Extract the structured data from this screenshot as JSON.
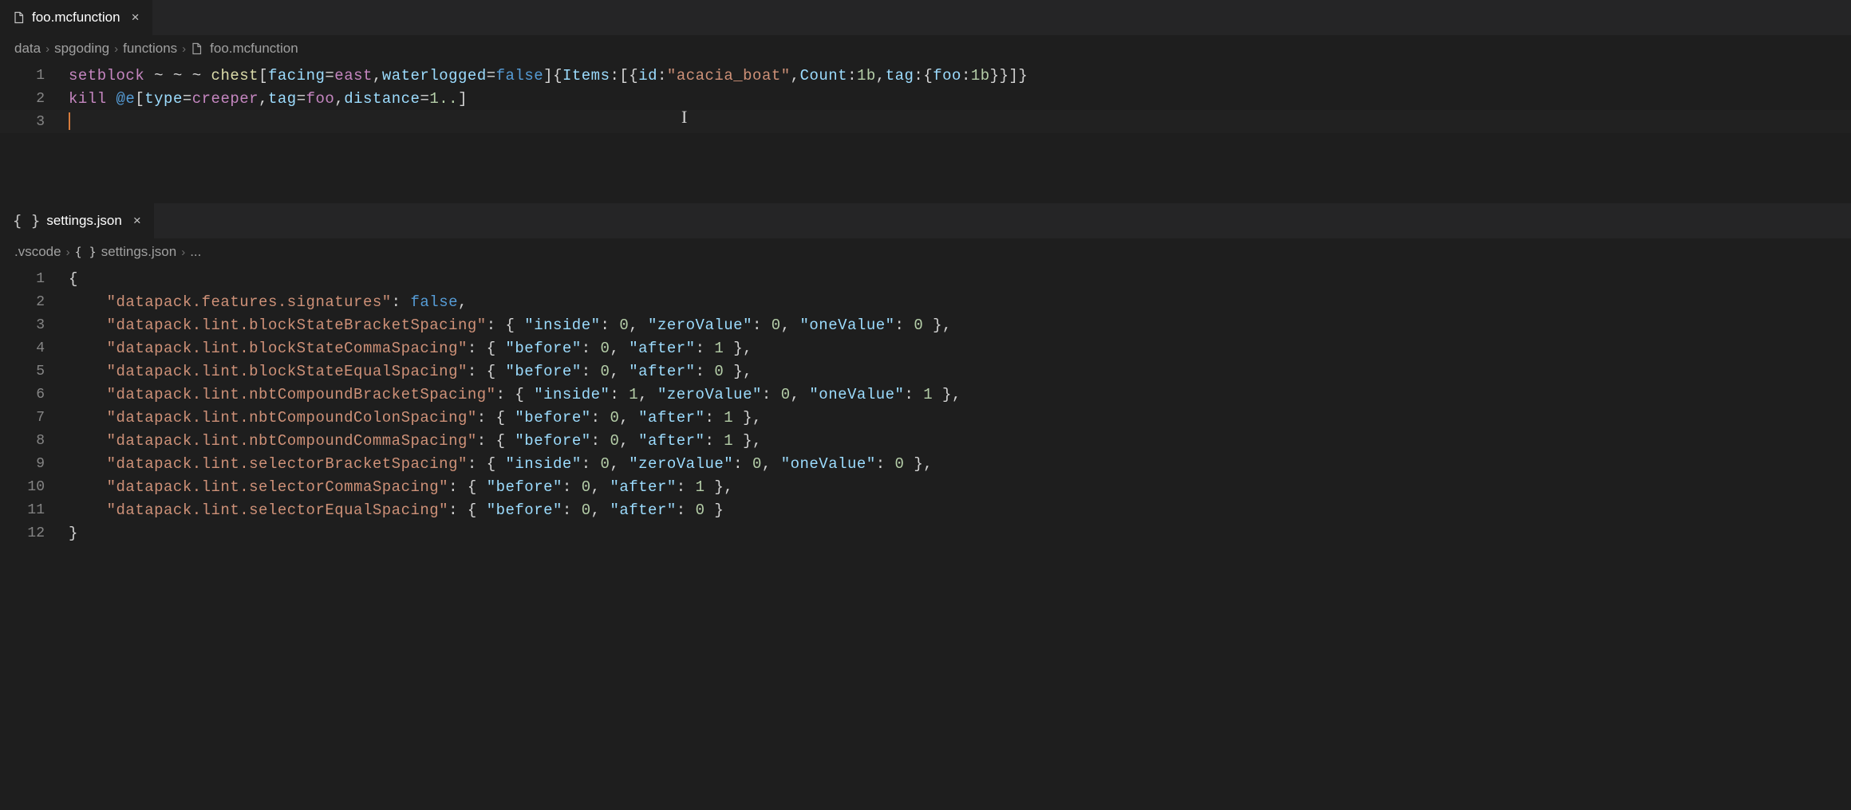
{
  "top_editor": {
    "tab": {
      "label": "foo.mcfunction"
    },
    "breadcrumbs": [
      "data",
      "spgoding",
      "functions",
      "foo.mcfunction"
    ],
    "lines": [
      {
        "n": "1",
        "segs": [
          {
            "c": "k-cmd",
            "t": "setblock"
          },
          {
            "c": "",
            "t": " ~ ~ ~ "
          },
          {
            "c": "k-block",
            "t": "chest"
          },
          {
            "c": "k-punct",
            "t": "["
          },
          {
            "c": "k-prop",
            "t": "facing"
          },
          {
            "c": "k-eq",
            "t": "="
          },
          {
            "c": "k-val",
            "t": "east"
          },
          {
            "c": "k-punct",
            "t": ","
          },
          {
            "c": "k-prop",
            "t": "waterlogged"
          },
          {
            "c": "k-eq",
            "t": "="
          },
          {
            "c": "k-bool",
            "t": "false"
          },
          {
            "c": "k-punct",
            "t": "]"
          },
          {
            "c": "k-brace",
            "t": "{"
          },
          {
            "c": "k-key",
            "t": "Items"
          },
          {
            "c": "k-punct",
            "t": ":["
          },
          {
            "c": "k-brace",
            "t": "{"
          },
          {
            "c": "k-key",
            "t": "id"
          },
          {
            "c": "k-punct",
            "t": ":"
          },
          {
            "c": "k-str",
            "t": "\"acacia_boat\""
          },
          {
            "c": "k-punct",
            "t": ","
          },
          {
            "c": "k-key",
            "t": "Count"
          },
          {
            "c": "k-punct",
            "t": ":"
          },
          {
            "c": "k-num",
            "t": "1b"
          },
          {
            "c": "k-punct",
            "t": ","
          },
          {
            "c": "k-key",
            "t": "tag"
          },
          {
            "c": "k-punct",
            "t": ":"
          },
          {
            "c": "k-brace",
            "t": "{"
          },
          {
            "c": "k-key",
            "t": "foo"
          },
          {
            "c": "k-punct",
            "t": ":"
          },
          {
            "c": "k-num",
            "t": "1b"
          },
          {
            "c": "k-brace",
            "t": "}}"
          },
          {
            "c": "k-punct",
            "t": "]"
          },
          {
            "c": "k-brace",
            "t": "}"
          }
        ]
      },
      {
        "n": "2",
        "segs": [
          {
            "c": "k-cmd",
            "t": "kill"
          },
          {
            "c": "",
            "t": " "
          },
          {
            "c": "k-sel",
            "t": "@e"
          },
          {
            "c": "k-punct",
            "t": "["
          },
          {
            "c": "k-prop",
            "t": "type"
          },
          {
            "c": "k-eq",
            "t": "="
          },
          {
            "c": "k-val",
            "t": "creeper"
          },
          {
            "c": "k-punct",
            "t": ","
          },
          {
            "c": "k-prop",
            "t": "tag"
          },
          {
            "c": "k-eq",
            "t": "="
          },
          {
            "c": "k-val",
            "t": "foo"
          },
          {
            "c": "k-punct",
            "t": ","
          },
          {
            "c": "k-prop",
            "t": "distance"
          },
          {
            "c": "k-eq",
            "t": "="
          },
          {
            "c": "k-range",
            "t": "1.."
          },
          {
            "c": "k-punct",
            "t": "]"
          }
        ]
      },
      {
        "n": "3",
        "segs": []
      }
    ]
  },
  "bottom_editor": {
    "tab": {
      "label": "settings.json"
    },
    "breadcrumbs": [
      ".vscode",
      "settings.json",
      "..."
    ],
    "lines": [
      {
        "n": "1",
        "segs": [
          {
            "c": "json-punct",
            "t": "{"
          }
        ]
      },
      {
        "n": "2",
        "segs": [
          {
            "c": "",
            "t": "    "
          },
          {
            "c": "json-str",
            "t": "\"datapack.features.signatures\""
          },
          {
            "c": "json-punct",
            "t": ": "
          },
          {
            "c": "json-bool",
            "t": "false"
          },
          {
            "c": "json-punct",
            "t": ","
          }
        ]
      },
      {
        "n": "3",
        "segs": [
          {
            "c": "",
            "t": "    "
          },
          {
            "c": "json-str",
            "t": "\"datapack.lint.blockStateBracketSpacing\""
          },
          {
            "c": "json-punct",
            "t": ": { "
          },
          {
            "c": "json-key",
            "t": "\"inside\""
          },
          {
            "c": "json-punct",
            "t": ": "
          },
          {
            "c": "json-num",
            "t": "0"
          },
          {
            "c": "json-punct",
            "t": ", "
          },
          {
            "c": "json-key",
            "t": "\"zeroValue\""
          },
          {
            "c": "json-punct",
            "t": ": "
          },
          {
            "c": "json-num",
            "t": "0"
          },
          {
            "c": "json-punct",
            "t": ", "
          },
          {
            "c": "json-key",
            "t": "\"oneValue\""
          },
          {
            "c": "json-punct",
            "t": ": "
          },
          {
            "c": "json-num",
            "t": "0"
          },
          {
            "c": "json-punct",
            "t": " },"
          }
        ]
      },
      {
        "n": "4",
        "segs": [
          {
            "c": "",
            "t": "    "
          },
          {
            "c": "json-str",
            "t": "\"datapack.lint.blockStateCommaSpacing\""
          },
          {
            "c": "json-punct",
            "t": ": { "
          },
          {
            "c": "json-key",
            "t": "\"before\""
          },
          {
            "c": "json-punct",
            "t": ": "
          },
          {
            "c": "json-num",
            "t": "0"
          },
          {
            "c": "json-punct",
            "t": ", "
          },
          {
            "c": "json-key",
            "t": "\"after\""
          },
          {
            "c": "json-punct",
            "t": ": "
          },
          {
            "c": "json-num",
            "t": "1"
          },
          {
            "c": "json-punct",
            "t": " },"
          }
        ]
      },
      {
        "n": "5",
        "segs": [
          {
            "c": "",
            "t": "    "
          },
          {
            "c": "json-str",
            "t": "\"datapack.lint.blockStateEqualSpacing\""
          },
          {
            "c": "json-punct",
            "t": ": { "
          },
          {
            "c": "json-key",
            "t": "\"before\""
          },
          {
            "c": "json-punct",
            "t": ": "
          },
          {
            "c": "json-num",
            "t": "0"
          },
          {
            "c": "json-punct",
            "t": ", "
          },
          {
            "c": "json-key",
            "t": "\"after\""
          },
          {
            "c": "json-punct",
            "t": ": "
          },
          {
            "c": "json-num",
            "t": "0"
          },
          {
            "c": "json-punct",
            "t": " },"
          }
        ]
      },
      {
        "n": "6",
        "segs": [
          {
            "c": "",
            "t": "    "
          },
          {
            "c": "json-str",
            "t": "\"datapack.lint.nbtCompoundBracketSpacing\""
          },
          {
            "c": "json-punct",
            "t": ": { "
          },
          {
            "c": "json-key",
            "t": "\"inside\""
          },
          {
            "c": "json-punct",
            "t": ": "
          },
          {
            "c": "json-num",
            "t": "1"
          },
          {
            "c": "json-punct",
            "t": ", "
          },
          {
            "c": "json-key",
            "t": "\"zeroValue\""
          },
          {
            "c": "json-punct",
            "t": ": "
          },
          {
            "c": "json-num",
            "t": "0"
          },
          {
            "c": "json-punct",
            "t": ", "
          },
          {
            "c": "json-key",
            "t": "\"oneValue\""
          },
          {
            "c": "json-punct",
            "t": ": "
          },
          {
            "c": "json-num",
            "t": "1"
          },
          {
            "c": "json-punct",
            "t": " },"
          }
        ]
      },
      {
        "n": "7",
        "segs": [
          {
            "c": "",
            "t": "    "
          },
          {
            "c": "json-str",
            "t": "\"datapack.lint.nbtCompoundColonSpacing\""
          },
          {
            "c": "json-punct",
            "t": ": { "
          },
          {
            "c": "json-key",
            "t": "\"before\""
          },
          {
            "c": "json-punct",
            "t": ": "
          },
          {
            "c": "json-num",
            "t": "0"
          },
          {
            "c": "json-punct",
            "t": ", "
          },
          {
            "c": "json-key",
            "t": "\"after\""
          },
          {
            "c": "json-punct",
            "t": ": "
          },
          {
            "c": "json-num",
            "t": "1"
          },
          {
            "c": "json-punct",
            "t": " },"
          }
        ]
      },
      {
        "n": "8",
        "segs": [
          {
            "c": "",
            "t": "    "
          },
          {
            "c": "json-str",
            "t": "\"datapack.lint.nbtCompoundCommaSpacing\""
          },
          {
            "c": "json-punct",
            "t": ": { "
          },
          {
            "c": "json-key",
            "t": "\"before\""
          },
          {
            "c": "json-punct",
            "t": ": "
          },
          {
            "c": "json-num",
            "t": "0"
          },
          {
            "c": "json-punct",
            "t": ", "
          },
          {
            "c": "json-key",
            "t": "\"after\""
          },
          {
            "c": "json-punct",
            "t": ": "
          },
          {
            "c": "json-num",
            "t": "1"
          },
          {
            "c": "json-punct",
            "t": " },"
          }
        ]
      },
      {
        "n": "9",
        "segs": [
          {
            "c": "",
            "t": "    "
          },
          {
            "c": "json-str",
            "t": "\"datapack.lint.selectorBracketSpacing\""
          },
          {
            "c": "json-punct",
            "t": ": { "
          },
          {
            "c": "json-key",
            "t": "\"inside\""
          },
          {
            "c": "json-punct",
            "t": ": "
          },
          {
            "c": "json-num",
            "t": "0"
          },
          {
            "c": "json-punct",
            "t": ", "
          },
          {
            "c": "json-key",
            "t": "\"zeroValue\""
          },
          {
            "c": "json-punct",
            "t": ": "
          },
          {
            "c": "json-num",
            "t": "0"
          },
          {
            "c": "json-punct",
            "t": ", "
          },
          {
            "c": "json-key",
            "t": "\"oneValue\""
          },
          {
            "c": "json-punct",
            "t": ": "
          },
          {
            "c": "json-num",
            "t": "0"
          },
          {
            "c": "json-punct",
            "t": " },"
          }
        ]
      },
      {
        "n": "10",
        "segs": [
          {
            "c": "",
            "t": "    "
          },
          {
            "c": "json-str",
            "t": "\"datapack.lint.selectorCommaSpacing\""
          },
          {
            "c": "json-punct",
            "t": ": { "
          },
          {
            "c": "json-key",
            "t": "\"before\""
          },
          {
            "c": "json-punct",
            "t": ": "
          },
          {
            "c": "json-num",
            "t": "0"
          },
          {
            "c": "json-punct",
            "t": ", "
          },
          {
            "c": "json-key",
            "t": "\"after\""
          },
          {
            "c": "json-punct",
            "t": ": "
          },
          {
            "c": "json-num",
            "t": "1"
          },
          {
            "c": "json-punct",
            "t": " },"
          }
        ]
      },
      {
        "n": "11",
        "segs": [
          {
            "c": "",
            "t": "    "
          },
          {
            "c": "json-str",
            "t": "\"datapack.lint.selectorEqualSpacing\""
          },
          {
            "c": "json-punct",
            "t": ": { "
          },
          {
            "c": "json-key",
            "t": "\"before\""
          },
          {
            "c": "json-punct",
            "t": ": "
          },
          {
            "c": "json-num",
            "t": "0"
          },
          {
            "c": "json-punct",
            "t": ", "
          },
          {
            "c": "json-key",
            "t": "\"after\""
          },
          {
            "c": "json-punct",
            "t": ": "
          },
          {
            "c": "json-num",
            "t": "0"
          },
          {
            "c": "json-punct",
            "t": " }"
          }
        ]
      },
      {
        "n": "12",
        "segs": [
          {
            "c": "json-punct",
            "t": "}"
          }
        ]
      }
    ]
  }
}
